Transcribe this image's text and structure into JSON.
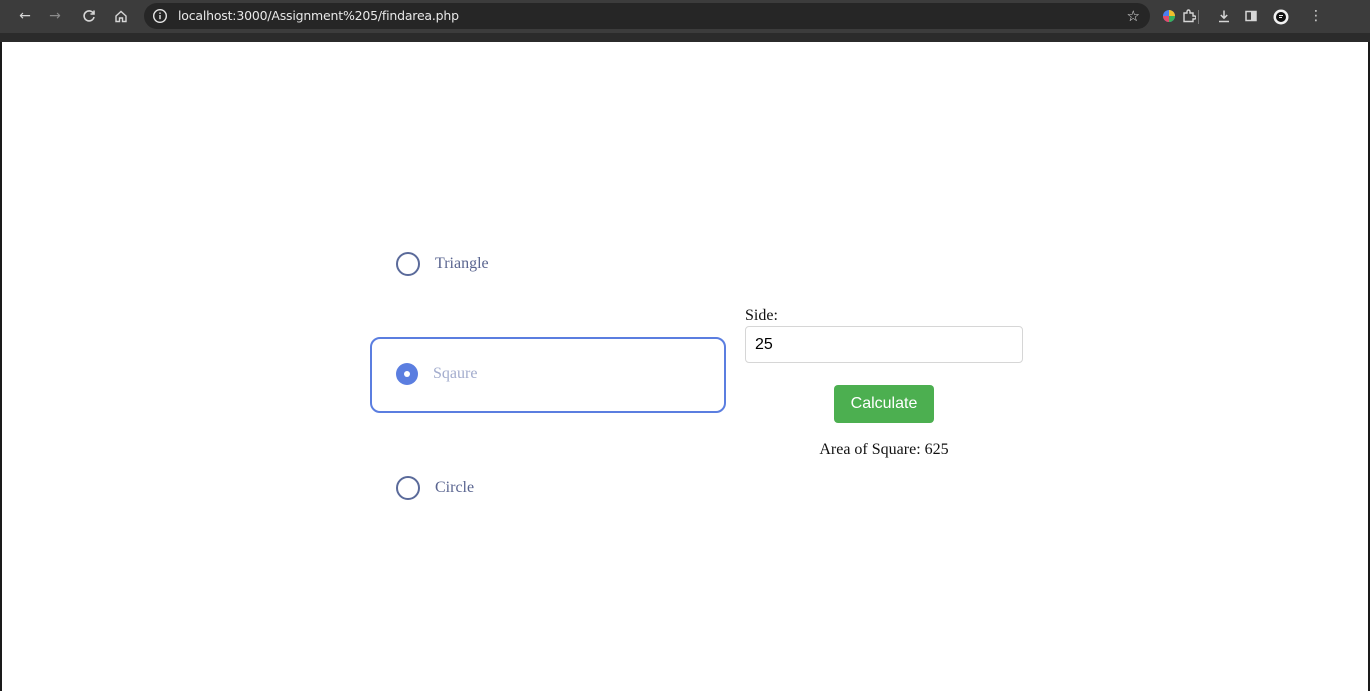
{
  "browser": {
    "url": "localhost:3000/Assignment%205/findarea.php"
  },
  "shapes": {
    "options": [
      {
        "label": "Triangle",
        "checked": false
      },
      {
        "label": "Sqaure",
        "checked": true
      },
      {
        "label": "Circle",
        "checked": false
      }
    ]
  },
  "form": {
    "side_label": "Side:",
    "side_value": "25",
    "calculate_label": "Calculate",
    "result_text": "Area of Square: 625"
  },
  "colors": {
    "accent": "#5b7ee0",
    "button": "#4caf50",
    "toolbar": "#3c3c3c"
  }
}
